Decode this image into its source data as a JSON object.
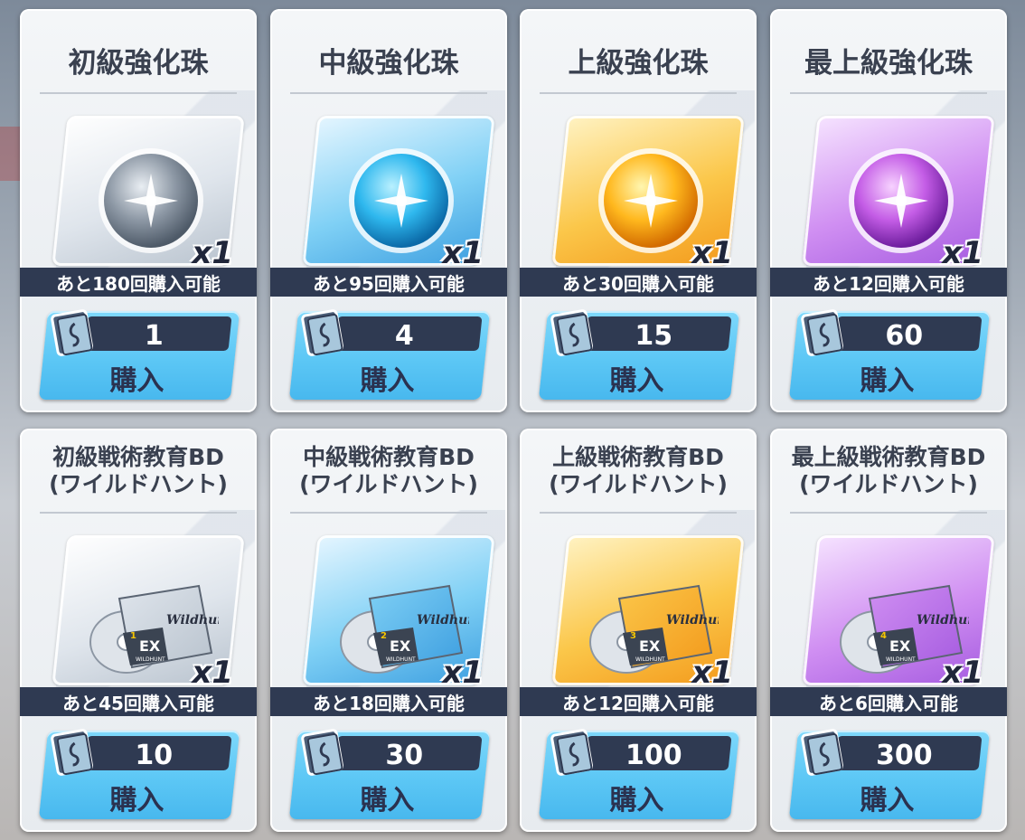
{
  "colors": {
    "tier_silver": "#c5ccd4",
    "tier_blue": "#6cc6f0",
    "tier_gold": "#f8c44a",
    "tier_purple": "#c27ae6",
    "label_bar": "#2f3a52",
    "buy_button": "#5cc7f5"
  },
  "cards": [
    {
      "name": "初級強化珠",
      "qty": "x1",
      "limit": "あと180回購入可能",
      "price": "1",
      "buy": "購入",
      "tier": "silver",
      "icon": "orb-icon"
    },
    {
      "name": "中級強化珠",
      "qty": "x1",
      "limit": "あと95回購入可能",
      "price": "4",
      "buy": "購入",
      "tier": "blue",
      "icon": "orb-icon"
    },
    {
      "name": "上級強化珠",
      "qty": "x1",
      "limit": "あと30回購入可能",
      "price": "15",
      "buy": "購入",
      "tier": "gold",
      "icon": "orb-icon"
    },
    {
      "name": "最上級強化珠",
      "qty": "x1",
      "limit": "あと12回購入可能",
      "price": "60",
      "buy": "購入",
      "tier": "purple",
      "icon": "orb-icon"
    },
    {
      "name": "初級戦術教育BD\n(ワイルドハント)",
      "qty": "x1",
      "limit": "あと45回購入可能",
      "price": "10",
      "buy": "購入",
      "tier": "silver",
      "icon": "bd-disc-icon",
      "badge": "EX",
      "brand": "Wildhunt",
      "sub": "WILDHUNT",
      "num": "1"
    },
    {
      "name": "中級戦術教育BD\n(ワイルドハント)",
      "qty": "x1",
      "limit": "あと18回購入可能",
      "price": "30",
      "buy": "購入",
      "tier": "blue",
      "icon": "bd-disc-icon",
      "badge": "EX",
      "brand": "Wildhunt",
      "sub": "WILDHUNT",
      "num": "2"
    },
    {
      "name": "上級戦術教育BD\n(ワイルドハント)",
      "qty": "x1",
      "limit": "あと12回購入可能",
      "price": "100",
      "buy": "購入",
      "tier": "gold",
      "icon": "bd-disc-icon",
      "badge": "EX",
      "brand": "Wildhunt",
      "sub": "WILDHUNT",
      "num": "3"
    },
    {
      "name": "最上級戦術教育BD\n(ワイルドハント)",
      "qty": "x1",
      "limit": "あと6回購入可能",
      "price": "300",
      "buy": "購入",
      "tier": "purple",
      "icon": "bd-disc-icon",
      "badge": "EX",
      "brand": "Wildhunt",
      "sub": "WILDHUNT",
      "num": "4"
    }
  ]
}
